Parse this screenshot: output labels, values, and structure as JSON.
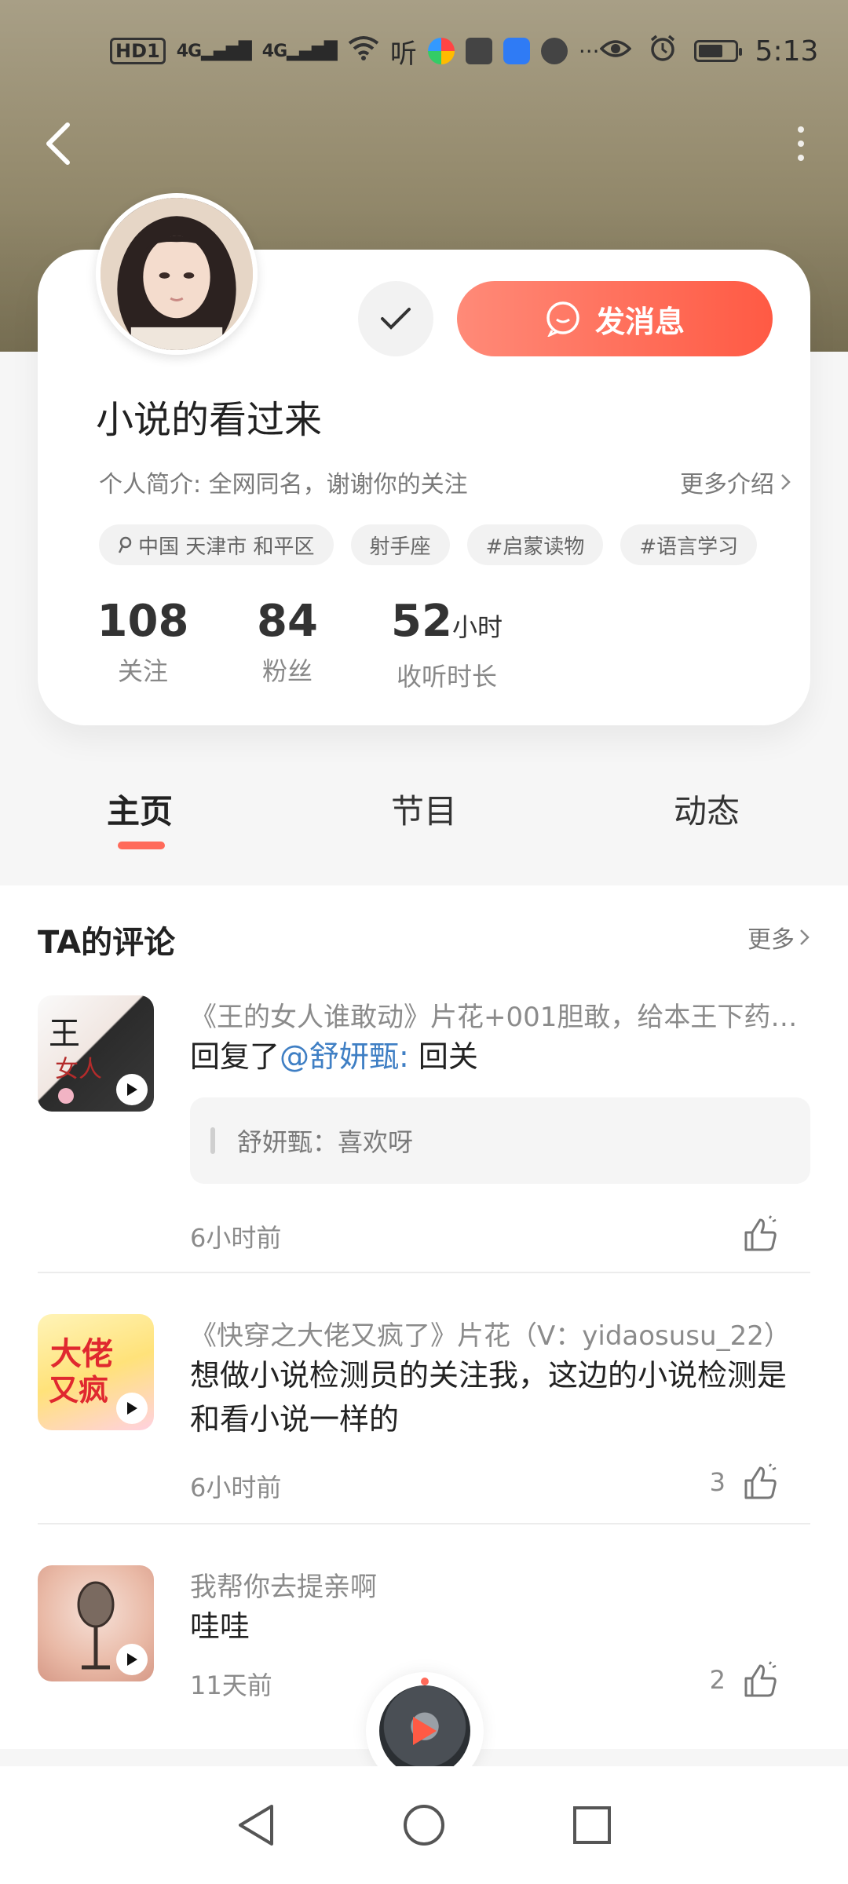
{
  "status_bar": {
    "left_items": [
      "HD1",
      "4G",
      "4G"
    ],
    "app_listen_label": "听",
    "overflow": "···",
    "time": "5:13"
  },
  "profile": {
    "username": "小说的看过来",
    "bio": "个人简介: 全网同名，谢谢你的关注",
    "more_intro": "更多介绍",
    "send_message": "发消息",
    "tags": [
      "中国 天津市 和平区",
      "射手座",
      "#启蒙读物",
      "#语言学习"
    ],
    "stats": [
      {
        "value": "108",
        "unit": "",
        "label": "关注"
      },
      {
        "value": "84",
        "unit": "",
        "label": "粉丝"
      },
      {
        "value": "52",
        "unit": "小时",
        "label": "收听时长"
      }
    ]
  },
  "tabs": [
    {
      "label": "主页",
      "active": true
    },
    {
      "label": "节目",
      "active": false
    },
    {
      "label": "动态",
      "active": false
    }
  ],
  "comments_section": {
    "title": "TA的评论",
    "more": "更多",
    "items": [
      {
        "source": "《王的女人谁敢动》片花+001胆敢，给本王下药…",
        "text_prefix": "回复了",
        "mention": "@舒妍甄:",
        "text_suffix": " 回关",
        "quote": "舒妍甄：喜欢呀",
        "time": "6小时前",
        "likes": ""
      },
      {
        "source": "《快穿之大佬又疯了》片花（V：yidaosusu_22）",
        "text": "想做小说检测员的关注我，这边的小说检测是和看小说一样的",
        "time": "6小时前",
        "likes": "3"
      },
      {
        "source": "我帮你去提亲啊",
        "text": "哇哇",
        "time": "11天前",
        "likes": "2"
      }
    ]
  },
  "colors": {
    "accent": "#ff5a44",
    "mention": "#3f7fc4",
    "tab_indicator": "#ff6a5a"
  },
  "icons": [
    "back-icon",
    "more-icon",
    "check-icon",
    "chat-bubble-icon",
    "location-icon",
    "chevron-right-icon",
    "play-icon",
    "thumb-up-icon",
    "nav-back-icon",
    "nav-home-icon",
    "nav-recents-icon"
  ]
}
